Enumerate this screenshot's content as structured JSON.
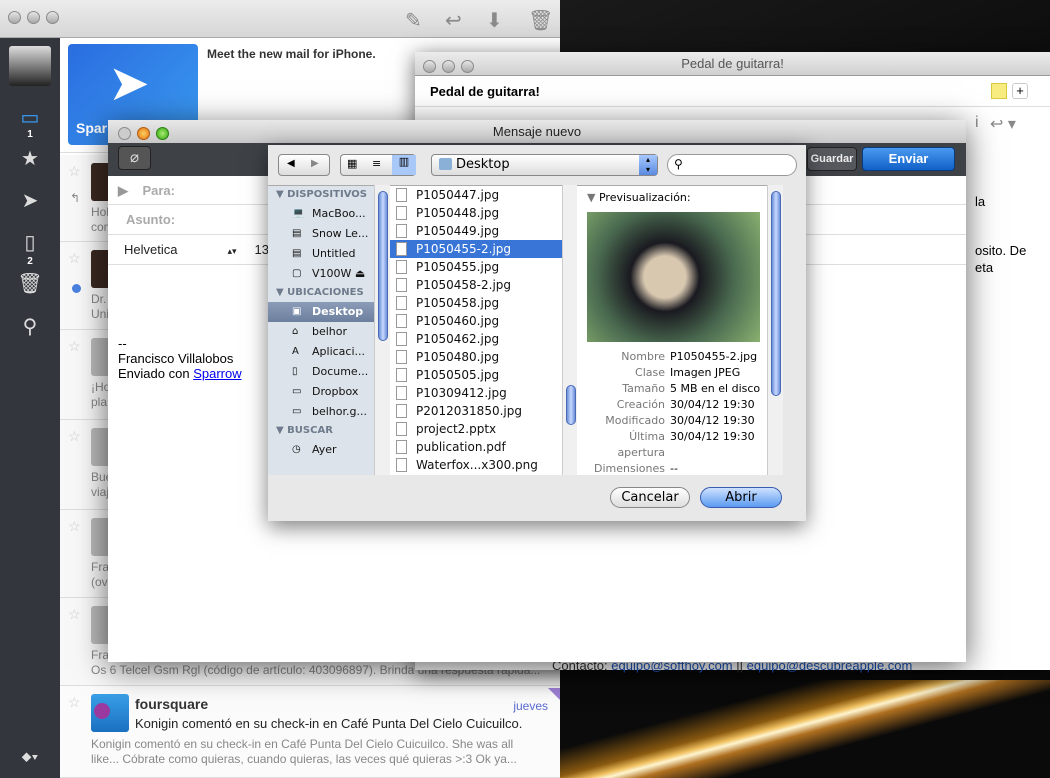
{
  "main": {
    "toolbar": [
      "compose-icon",
      "reply-icon",
      "archive-icon",
      "trash-icon"
    ],
    "sidebar": {
      "inbox_count": "1",
      "drafts_count": "2"
    },
    "promo": {
      "title": "Meet the new mail for iPhone.",
      "app": "Sparrow"
    },
    "rows": [
      {
        "preview": "Hol\ncon"
      },
      {
        "preview": "Dr.\nUni"
      },
      {
        "preview": "¡Ho\npla"
      },
      {
        "preview": "Bue\nviaj"
      },
      {
        "preview": "Fra\n(ov"
      },
      {
        "preview": "Fra\nOs 6 Telcel Gsm Rgl (código de artículo: 403096897). Brinda una respuesta rápida..."
      }
    ],
    "foursquare": {
      "sender": "foursquare",
      "date": "jueves",
      "subject": "Konigin comentó en su check-in en Café Punta Del Cielo Cuicuilco.",
      "preview": "Konigin comentó en su check-in en Café Punta Del Cielo Cuicuilco. She was all like... Cóbrate como quieras, cuando quieras, las veces qué quieras >:3 Ok ya..."
    }
  },
  "pedal": {
    "window_title": "Pedal de guitarra!",
    "subject": "Pedal de guitarra!",
    "body1": "la",
    "body2": "osito. De",
    "body3": "eta",
    "contact_label": "Contacto:",
    "contact1": "equipo@softhoy.com",
    "sep": "||",
    "contact2": "equipo@descubreapple.com"
  },
  "compose": {
    "window_title": "Mensaje nuevo",
    "save": "Guardar",
    "save_visible": "ardar",
    "send": "Enviar",
    "to_label": "Para:",
    "subject_label": "Asunto:",
    "font": "Helvetica",
    "size": "13",
    "sig_dash": "--",
    "sig_name": "Francisco Villalobos",
    "sig_sent": "Enviado con",
    "sig_link": "Sparrow"
  },
  "dialog": {
    "location": "Desktop",
    "search_placeholder": "",
    "sections": [
      {
        "title": "DISPOSITIVOS",
        "items": [
          "MacBoo...",
          "Snow Le...",
          "Untitled",
          "V100W"
        ]
      },
      {
        "title": "UBICACIONES",
        "items": [
          "Desktop",
          "belhor",
          "Aplicaci...",
          "Docume...",
          "Dropbox",
          "belhor.g..."
        ]
      },
      {
        "title": "BUSCAR",
        "items": [
          "Ayer"
        ]
      }
    ],
    "selected_place": "Desktop",
    "files": [
      "P1050447.jpg",
      "P1050448.jpg",
      "P1050449.jpg",
      "P1050455-2.jpg",
      "P1050455.jpg",
      "P1050458-2.jpg",
      "P1050458.jpg",
      "P1050460.jpg",
      "P1050462.jpg",
      "P1050480.jpg",
      "P1050505.jpg",
      "P10309412.jpg",
      "P2012031850.jpg",
      "project2.pptx",
      "publication.pdf",
      "Waterfox...x300.png"
    ],
    "selected_file": "P1050455-2.jpg",
    "preview_label": "Previsualización:",
    "meta": [
      {
        "k": "Nombre",
        "v": "P1050455-2.jpg"
      },
      {
        "k": "Clase",
        "v": "Imagen JPEG"
      },
      {
        "k": "Tamaño",
        "v": "5 MB en el disco"
      },
      {
        "k": "Creación",
        "v": "30/04/12 19:30"
      },
      {
        "k": "Modificado",
        "v": "30/04/12 19:30"
      },
      {
        "k": "Última",
        "v": "30/04/12 19:30"
      },
      {
        "k": "apertura",
        "v": ""
      },
      {
        "k": "Dimensiones",
        "v": "--"
      }
    ],
    "cancel": "Cancelar",
    "open": "Abrir"
  },
  "colors": {
    "selection": "#3875d7",
    "send": "#1a6fd8",
    "sidebar": "#33373d",
    "link": "#1a55c0"
  }
}
